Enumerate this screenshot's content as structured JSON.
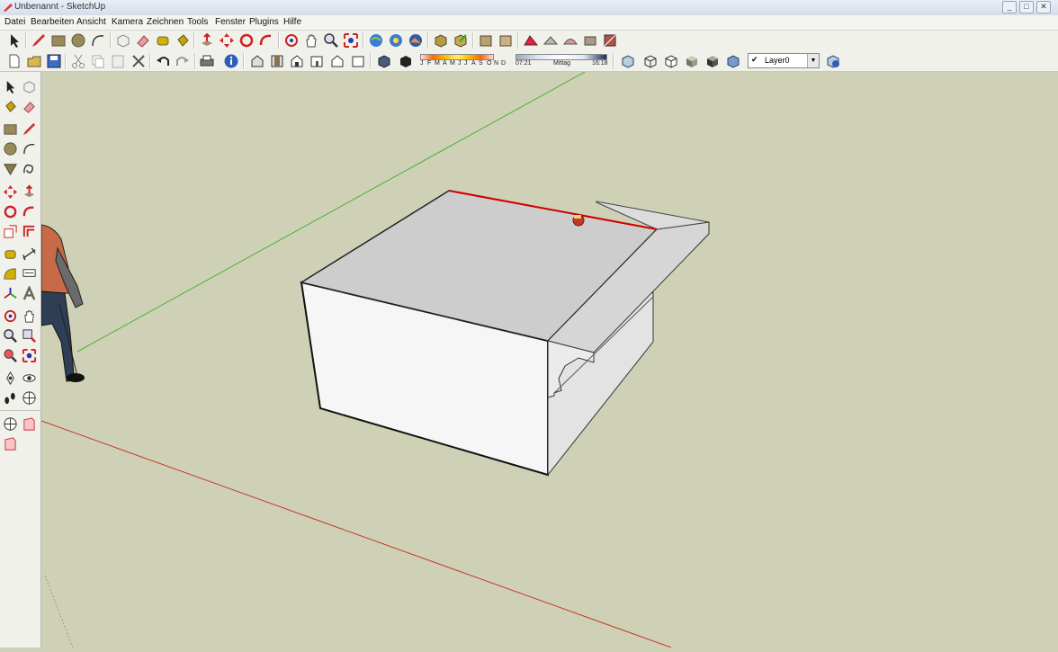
{
  "window": {
    "title": "Unbenannt - SketchUp",
    "controls": [
      "_",
      "□",
      "✕"
    ]
  },
  "menu": [
    "Datei",
    "Bearbeiten",
    "Ansicht",
    "Kamera",
    "Zeichnen",
    "Tools",
    "Fenster",
    "Plugins",
    "Hilfe"
  ],
  "shadow": {
    "months": [
      "J",
      "F",
      "M",
      "A",
      "M",
      "J",
      "J",
      "A",
      "S",
      "O",
      "N",
      "D"
    ],
    "time_start": "07:21",
    "time_mid": "Mittag",
    "time_end": "16:18"
  },
  "layer": {
    "selected": "Layer0"
  },
  "colors": {
    "axis_green": "#4fae3a",
    "axis_red": "#c0392b",
    "ground": "#cfd1b6",
    "selection_red": "#d00000"
  }
}
